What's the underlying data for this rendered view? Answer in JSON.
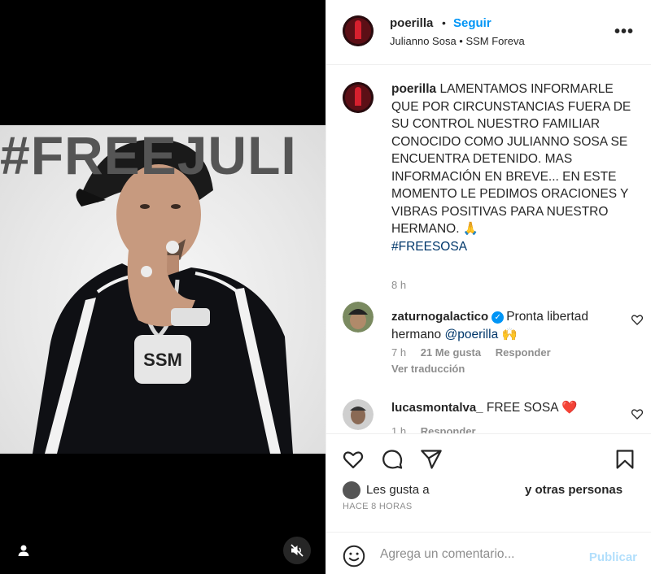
{
  "media": {
    "overlay_text": "#FREEJULI",
    "icons": {
      "user_tag": "user-icon",
      "mute": "speaker-muted-icon"
    }
  },
  "header": {
    "username": "poerilla",
    "separator": "•",
    "follow_label": "Seguir",
    "subtitle": "Julianno Sosa • SSM Foreva",
    "more_label": "•••"
  },
  "caption": {
    "username": "poerilla",
    "text": "LAMENTAMOS INFORMARLE QUE POR CIRCUNSTANCIAS FUERA DE SU CONTROL NUESTRO FAMILIAR CONOCIDO COMO JULIANNO SOSA SE ENCUENTRA DETENIDO. MAS INFORMACIÓN EN BREVE... EN ESTE MOMENTO LE PEDIMOS ORACIONES Y VIBRAS POSITIVAS PARA NUESTRO HERMANO. 🙏",
    "hashtag": "#FREESOSA",
    "time": "8 h"
  },
  "comments": [
    {
      "username": "zaturnogalactico",
      "verified": true,
      "text_before": "Pronta libertad hermano ",
      "mention": "@poerilla",
      "emoji": "🙌",
      "time": "7 h",
      "likes": "21 Me gusta",
      "reply_label": "Responder",
      "translate_label": "Ver traducción"
    },
    {
      "username": "lucasmontalva_",
      "verified": false,
      "text_before": "FREE SOSA ",
      "emoji": "❤️",
      "time": "1 h",
      "reply_label": "Responder"
    }
  ],
  "actions": {
    "icons": [
      "heart-icon",
      "comment-icon",
      "share-icon",
      "bookmark-icon"
    ],
    "likes_prefix": "Les gusta a",
    "likes_suffix": "y otras personas",
    "posted_ago": "HACE 8 HORAS"
  },
  "comment_bar": {
    "placeholder": "Agrega un comentario...",
    "publish_label": "Publicar"
  },
  "colors": {
    "accent": "#0095f6",
    "text": "#262626",
    "muted": "#8e8e8e",
    "publish_disabled": "#b2dffc",
    "heart_red": "#ed4956"
  }
}
